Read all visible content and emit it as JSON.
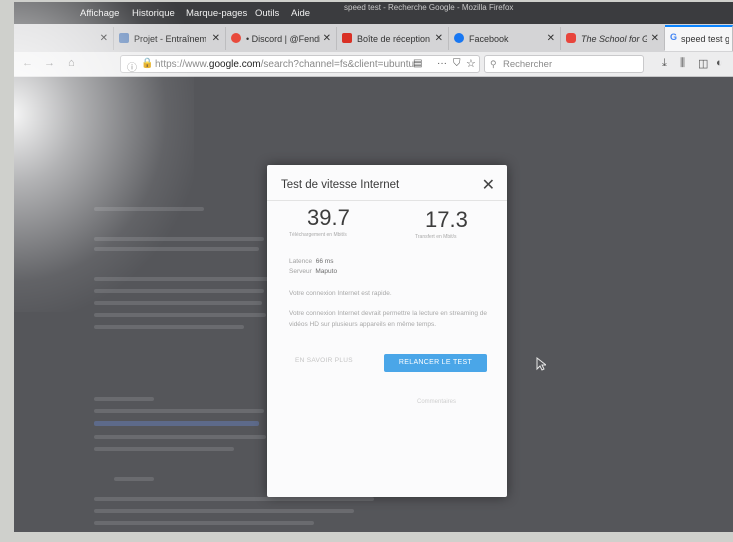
{
  "window": {
    "title": "speed test - Recherche Google - Mozilla Firefox"
  },
  "menu": [
    "Affichage",
    "Historique",
    "Marque-pages",
    "Outils",
    "Aide"
  ],
  "tabs": [
    {
      "label": "",
      "favicon": "",
      "close": "✕"
    },
    {
      "label": "Projet - Entraînem",
      "favicon": "#6d8fc0",
      "close": "✕"
    },
    {
      "label": "• Discord | @Fendi",
      "favicon": "#e84a3c",
      "close": "✕"
    },
    {
      "label": "Boîte de réception",
      "favicon": "#d93025",
      "close": "✕"
    },
    {
      "label": "Facebook",
      "favicon": "#1877f2",
      "close": "✕"
    },
    {
      "label": "The School for Go",
      "favicon": "#e8453c",
      "close": "✕"
    },
    {
      "label": "speed test goo",
      "favicon": "#4285f4",
      "close": ""
    }
  ],
  "nav": {
    "url_prefix": "https://www.",
    "url_domain": "google.com",
    "url_path": "/search?channel=fs&client=ubuntu",
    "search_placeholder": "Rechercher",
    "more_icon": "···"
  },
  "dialog": {
    "title": "Test de vitesse Internet",
    "close": "✕",
    "download_value": "39.7",
    "download_label": "Téléchargement en Mbit/s",
    "upload_value": "17.3",
    "upload_label": "Transfert en Mbit/s",
    "latency_label": "Latence",
    "latency_value": "66 ms",
    "server_label": "Serveur",
    "server_value": "Maputo",
    "message_fast": "Votre connexion Internet est rapide.",
    "message_detail": "Votre connexion Internet devrait permettre la lecture en streaming de vidéos HD sur plusieurs appareils en même temps.",
    "learn_more": "EN SAVOIR PLUS",
    "retest": "RELANCER LE TEST",
    "feedback": "Commentaires"
  }
}
